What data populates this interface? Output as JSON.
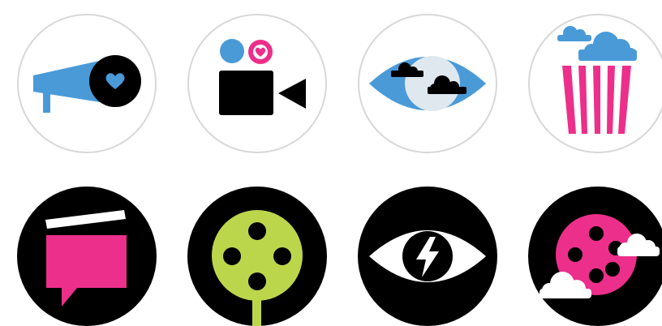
{
  "colors": {
    "blue": "#4a9ad8",
    "pink": "#ec2f8a",
    "lime": "#bcd64c",
    "black": "#000000",
    "white": "#ffffff",
    "ring": "#d8d8d8"
  },
  "icons": [
    {
      "name": "megaphone-heart-icon",
      "style": "outlined-circle"
    },
    {
      "name": "video-camera-heart-icon",
      "style": "outlined-circle"
    },
    {
      "name": "eye-clouds-icon",
      "style": "outlined-circle"
    },
    {
      "name": "popcorn-icon",
      "style": "outlined-circle"
    },
    {
      "name": "clapperboard-chat-icon",
      "style": "filled-circle"
    },
    {
      "name": "film-reel-tree-icon",
      "style": "filled-circle"
    },
    {
      "name": "eye-lightning-icon",
      "style": "filled-circle"
    },
    {
      "name": "film-reel-clouds-icon",
      "style": "filled-circle"
    }
  ]
}
